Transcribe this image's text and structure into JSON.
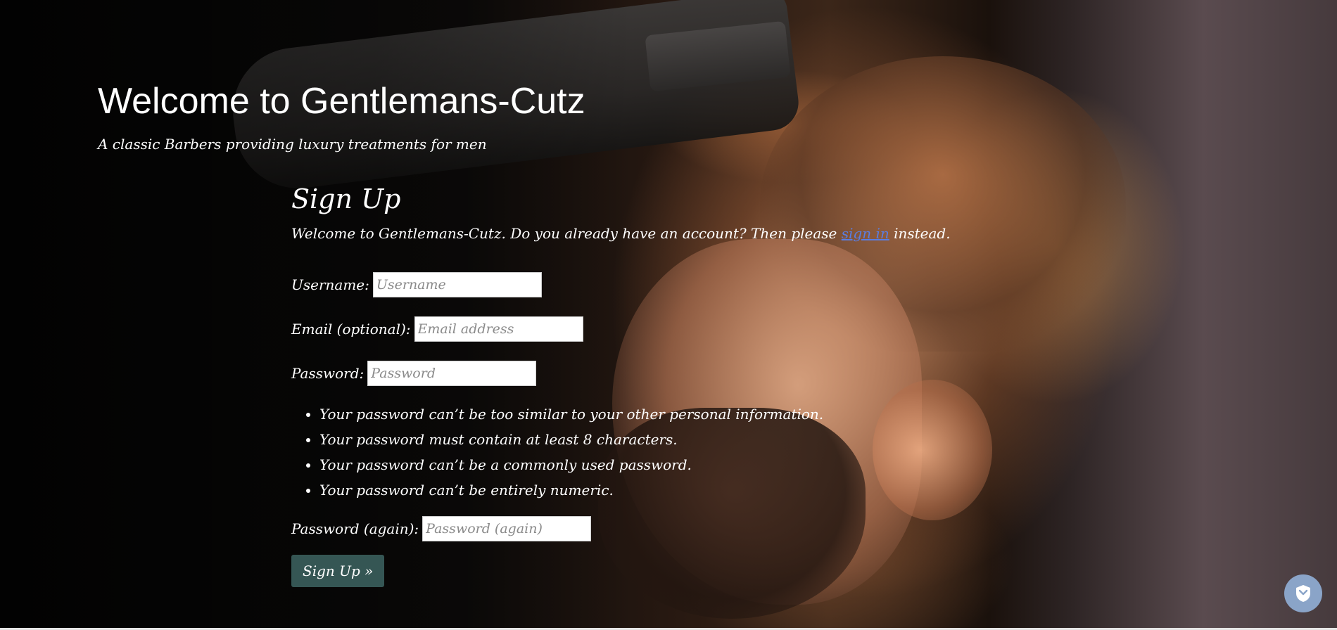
{
  "site": {
    "title": "Welcome to Gentlemans-Cutz",
    "tagline": "A classic Barbers providing luxury treatments for men"
  },
  "signup": {
    "heading": "Sign Up",
    "intro_before": "Welcome to Gentlemans-Cutz. Do you already have an account? Then please ",
    "intro_link": "sign in",
    "intro_after": " instead.",
    "fields": {
      "username": {
        "label": "Username:",
        "placeholder": "Username",
        "value": ""
      },
      "email": {
        "label": "Email (optional):",
        "placeholder": "Email address",
        "value": ""
      },
      "password": {
        "label": "Password:",
        "placeholder": "Password",
        "value": ""
      },
      "password_again": {
        "label": "Password (again):",
        "placeholder": "Password (again)",
        "value": ""
      }
    },
    "password_rules": [
      "Your password can’t be too similar to your other personal information.",
      "Your password must contain at least 8 characters.",
      "Your password can’t be a commonly used password.",
      "Your password can’t be entirely numeric."
    ],
    "submit_label": "Sign Up »"
  },
  "widgets": {
    "security_badge_icon": "shield-icon"
  },
  "colors": {
    "link": "#5a7de0",
    "button_bg": "#355654",
    "badge_bg": "#8aa4c8"
  }
}
